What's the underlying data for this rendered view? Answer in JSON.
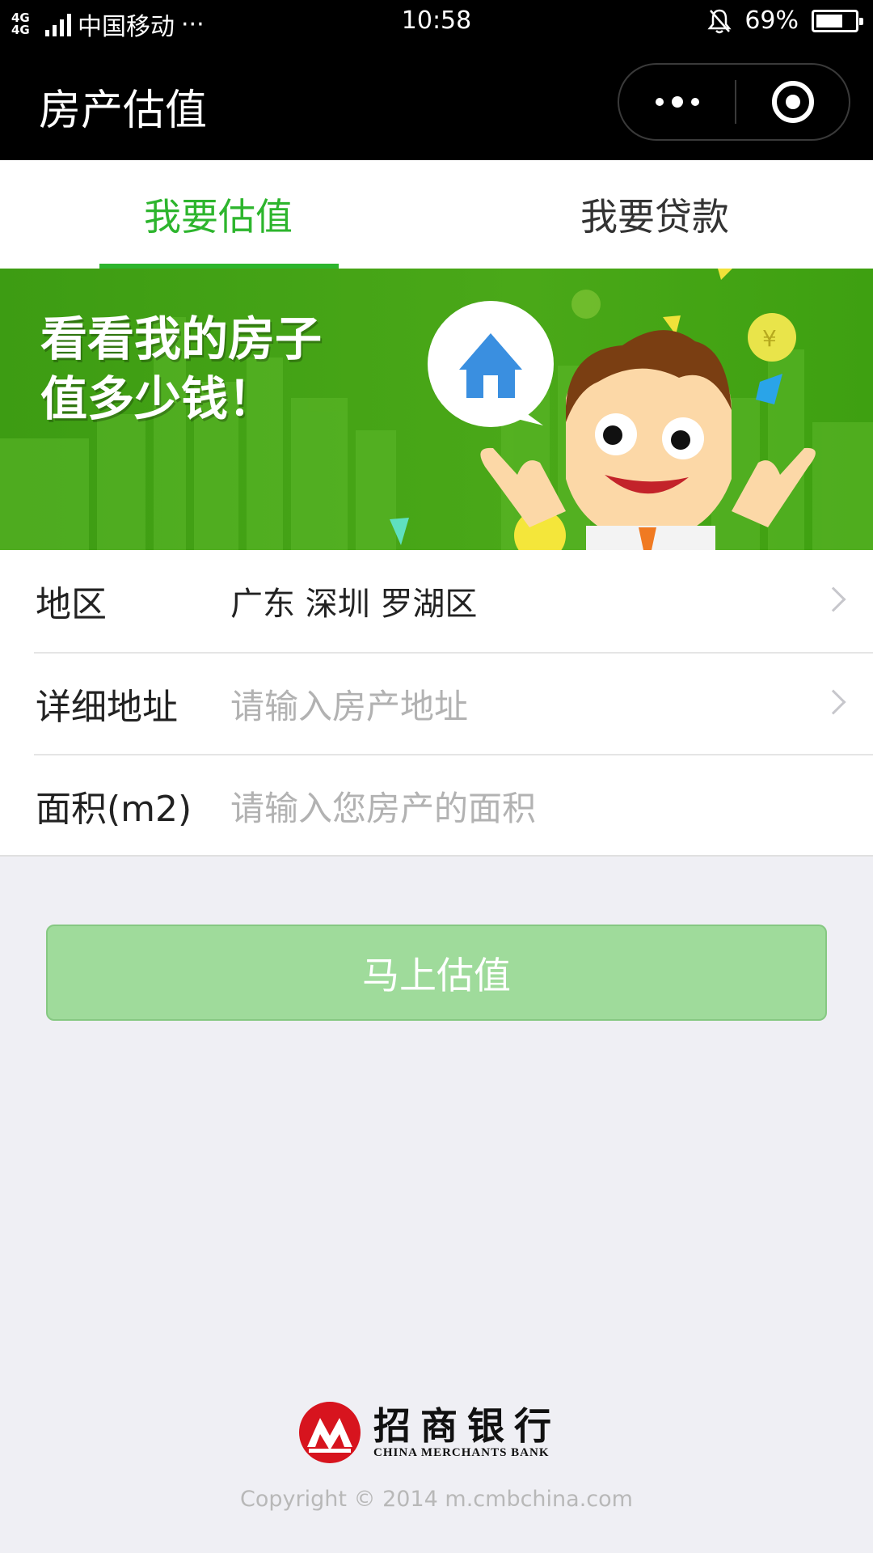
{
  "status_bar": {
    "network": "4G 4G",
    "carrier": "中国移动",
    "more": "···",
    "time": "10:58",
    "battery": "69%",
    "battery_level": 0.69
  },
  "title_bar": {
    "title": "房产估值"
  },
  "tabs": [
    {
      "label": "我要估值",
      "active": true
    },
    {
      "label": "我要贷款",
      "active": false
    }
  ],
  "banner": {
    "line1": "看看我的房子",
    "line2": "值多少钱！"
  },
  "form": {
    "region_label": "地区",
    "region_value": "广东 深圳 罗湖区",
    "address_label": "详细地址",
    "address_placeholder": "请输入房产地址",
    "area_label": "面积(m2)",
    "area_placeholder": "请输入您房产的面积"
  },
  "submit_label": "马上估值",
  "footer": {
    "bank_name_cn": "招商银行",
    "bank_name_en": "CHINA MERCHANTS BANK",
    "copyright": "Copyright © 2014 m.cmbchina.com"
  },
  "colors": {
    "accent": "#2db52d",
    "button": "#9fdb9b",
    "banner": "#4aa818",
    "logo_red": "#d7141e"
  }
}
